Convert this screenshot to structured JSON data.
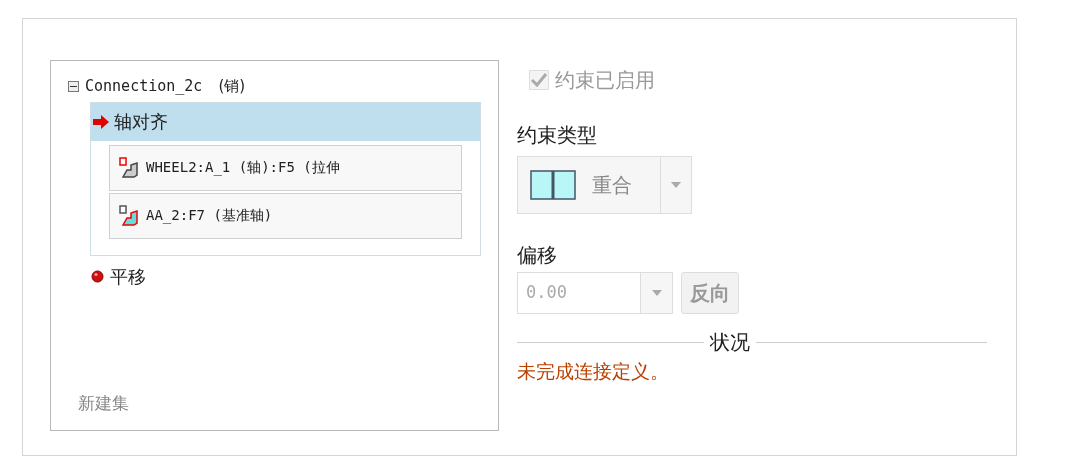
{
  "tree": {
    "root": {
      "label": "Connection_2c",
      "suffix": "(销)",
      "expanded": true
    },
    "constraints": [
      {
        "kind": "arrow",
        "label": "轴对齐",
        "selected": true,
        "references": [
          {
            "kind": "part",
            "label": "WHEEL2:A_1 (轴):F5 (拉伸"
          },
          {
            "kind": "datum",
            "label": "AA_2:F7 (基准轴)"
          }
        ]
      },
      {
        "kind": "dot",
        "label": "平移",
        "selected": false
      }
    ],
    "new_set": "新建集"
  },
  "enabled": {
    "label": "约束已启用",
    "checked": true,
    "disabled": true
  },
  "constraint_type": {
    "label": "约束类型",
    "value": "重合"
  },
  "offset": {
    "label": "偏移",
    "value": "0.00",
    "flip_button": "反向"
  },
  "status": {
    "heading": "状况",
    "message": "未完成连接定义。"
  }
}
